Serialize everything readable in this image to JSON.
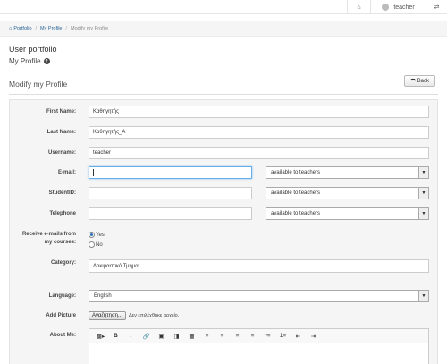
{
  "topbar": {
    "user_name": "teacher"
  },
  "breadcrumb": {
    "items": [
      "Portfolio",
      "My Profile",
      "Modify my Profile"
    ]
  },
  "page": {
    "title": "User portfolio",
    "subtitle": "My Profile",
    "section_title": "Modify my Profile",
    "back_label": "Back"
  },
  "form": {
    "first_name": {
      "label": "First Name:",
      "value": "Καθηγητής"
    },
    "last_name": {
      "label": "Last Name:",
      "value": "Καθηγητής_Α"
    },
    "username": {
      "label": "Username:",
      "value": "teacher"
    },
    "email": {
      "label": "E-mail:",
      "value": "",
      "visibility": "available to teachers"
    },
    "student_id": {
      "label": "StudentID:",
      "value": "",
      "visibility": "available to teachers"
    },
    "telephone": {
      "label": "Telephone",
      "value": "",
      "visibility": "available to teachers"
    },
    "receive_emails": {
      "label_line1": "Receive e-mails from",
      "label_line2": "my courses:",
      "options": [
        "Yes",
        "No"
      ],
      "selected": "Yes"
    },
    "category": {
      "label": "Category:",
      "value": "Δοκιμαστικό Τμήμα"
    },
    "language": {
      "label": "Language:",
      "value": "English"
    },
    "picture": {
      "label": "Add Picture",
      "button": "Αναζήτηση...",
      "status": "Δεν επιλέχθηκε αρχείο."
    },
    "about": {
      "label": "About Me:"
    }
  },
  "icons": {
    "home": "home-icon",
    "user": "user-icon",
    "menu": "menu-toggle-icon",
    "back": "back-arrow-icon",
    "help": "help-icon",
    "dropdown": "chevron-down-icon"
  }
}
